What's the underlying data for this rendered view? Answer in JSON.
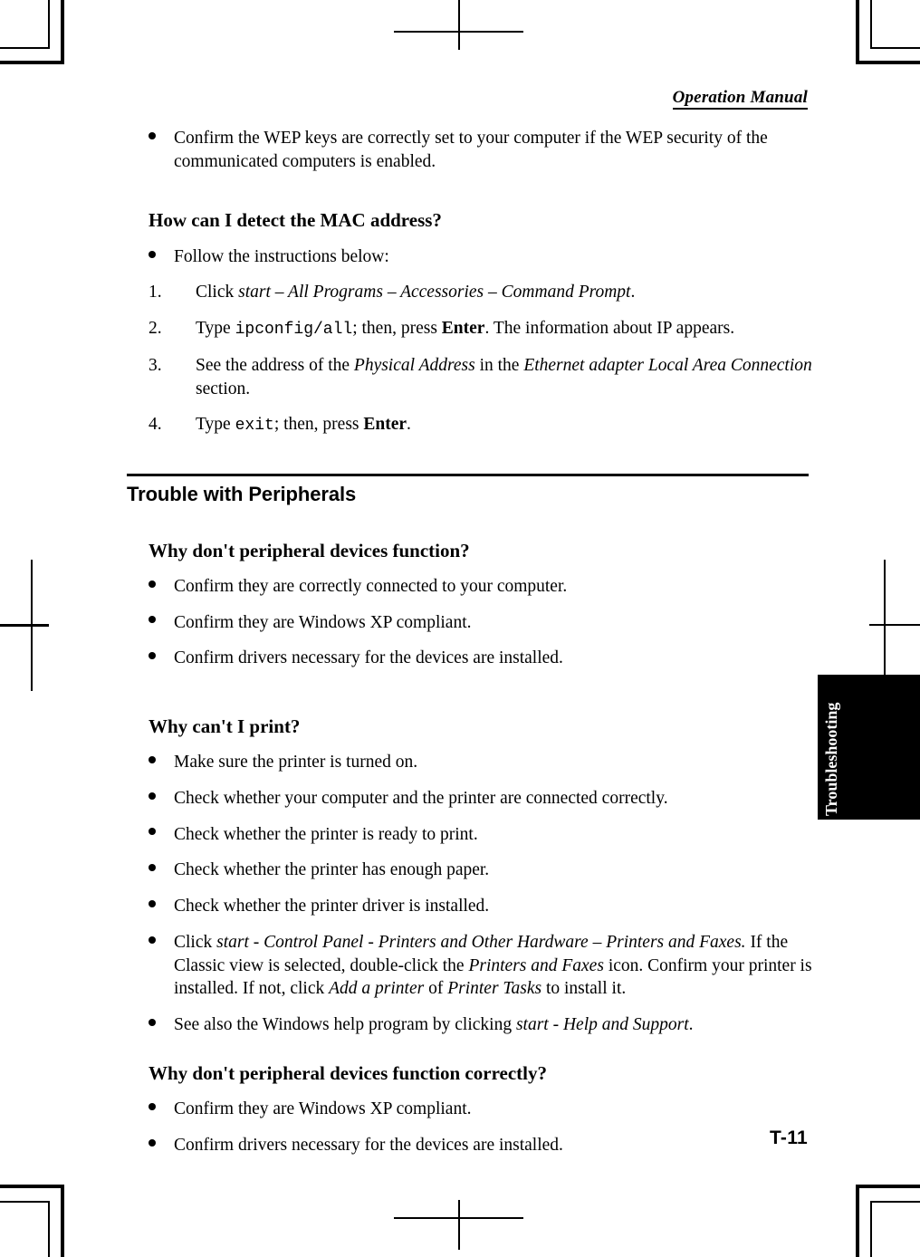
{
  "document": {
    "running_head": "Operation Manual",
    "page_number": "T-11",
    "thumb_tab": "Troubleshooting"
  },
  "blocks": {
    "wep_bullet": "Confirm the WEP keys are correctly set to your computer if the WEP security of the communicated computers is enabled.",
    "mac_heading": "How can I detect the MAC address?",
    "mac_intro_bullet": "Follow the instructions below:",
    "steps": [
      {
        "number": "1.",
        "pre": "Click ",
        "italic": "start – All Programs – Accessories – Command Prompt",
        "post": "."
      },
      {
        "number": "2.",
        "pre": "Type ",
        "mono": "ipconfig/all",
        "mid": "; then, press ",
        "bold": "Enter",
        "post": ". The information about IP appears."
      },
      {
        "number": "3.",
        "pre": "See the address of the ",
        "italic": "Physical Address",
        "mid": " in the ",
        "italic2": "Ethernet adapter Local Area Connection",
        "post": " section."
      },
      {
        "number": "4.",
        "pre": "Type ",
        "mono": "exit",
        "mid": "; then, press ",
        "bold": "Enter",
        "post": "."
      }
    ],
    "section_title": "Trouble with Peripherals",
    "q1_heading": "Why don't peripheral devices function?",
    "q1_bullets": [
      "Confirm they are correctly connected to your computer.",
      "Confirm they are Windows XP compliant.",
      "Confirm drivers necessary for the devices are installed."
    ],
    "q2_heading": "Why can't I print?",
    "q2_bullets": [
      "Make sure the printer is turned on.",
      "Check whether your computer and the printer are connected correctly.",
      "Check whether the printer is ready to print.",
      "Check whether the printer has enough paper.",
      "Check whether the printer driver is installed."
    ],
    "q2_control_panel_bullet": {
      "pre": "Click ",
      "italic": "start - Control Panel - Printers and Other Hardware – Printers and Faxes.",
      "mid": " If the Classic view is selected, double-click the ",
      "italic2": "Printers and Faxes",
      "mid2": " icon. Confirm your printer is installed. If not, click ",
      "italic3": "Add a printer",
      "mid3": " of ",
      "italic4": "Printer Tasks",
      "post": " to install it."
    },
    "q2_help_bullet": {
      "pre": "See also the Windows help program by clicking ",
      "italic": "start - Help and Support",
      "post": "."
    },
    "q3_heading": "Why don't peripheral devices function correctly?",
    "q3_bullets": [
      "Confirm they are Windows XP compliant.",
      "Confirm drivers necessary for the devices are installed."
    ]
  }
}
